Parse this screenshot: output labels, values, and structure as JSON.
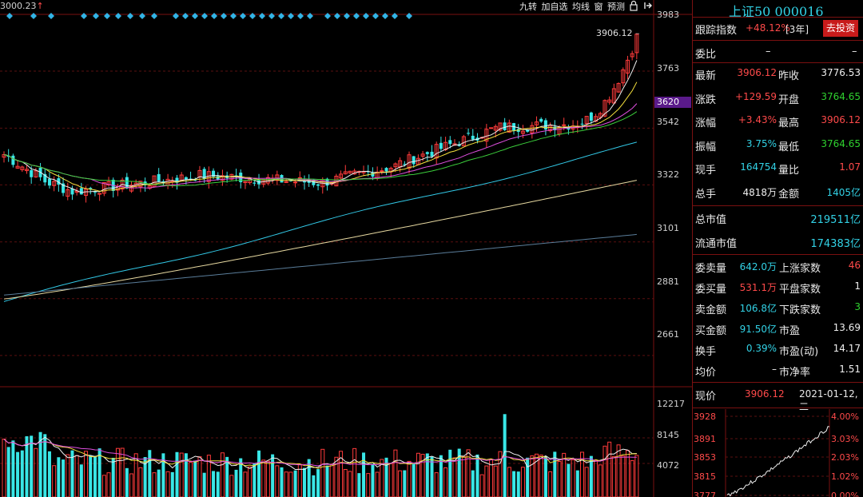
{
  "toolbar": {
    "top_left_label": "3000.23",
    "buttons": [
      "九转",
      "加自选",
      "均线",
      "窗",
      "预测"
    ],
    "lock_icon": "lock-icon",
    "pin_icon": "pin-icon"
  },
  "price_axis": {
    "labels": [
      "3983",
      "3763",
      "3620",
      "3542",
      "3322",
      "3101",
      "2881",
      "2661"
    ],
    "highlight": "3620",
    "highlight_color": "#5a1a8a"
  },
  "volume_axis": {
    "labels": [
      "12217",
      "8145",
      "4072"
    ]
  },
  "chart_annotation": {
    "high_label": "3906.12"
  },
  "chart_data": {
    "type": "candlestick",
    "y_range": [
      2550,
      3983
    ],
    "last_close": 3906.12,
    "prior_close": 3776.53,
    "open": 3764.65,
    "high": 3906.12,
    "low": 3764.65,
    "moving_averages": [
      "yellow",
      "white",
      "magenta",
      "green",
      "cyan",
      "beige",
      "blue-gray"
    ]
  },
  "panel": {
    "title": "上证50 000016",
    "track_label": "跟踪指数",
    "track_value": "+48.12%",
    "track_period": "[3年]",
    "invest_button": "去投资",
    "webi_label": "委比",
    "webi_value1": "–",
    "webi_value2": "–",
    "quote": [
      {
        "l1": "最新",
        "v1": "3906.12",
        "c1": "red",
        "l2": "昨收",
        "v2": "3776.53",
        "c2": "white"
      },
      {
        "l1": "涨跌",
        "v1": "+129.59",
        "c1": "red",
        "l2": "开盘",
        "v2": "3764.65",
        "c2": "green"
      },
      {
        "l1": "涨幅",
        "v1": "+3.43%",
        "c1": "red",
        "l2": "最高",
        "v2": "3906.12",
        "c2": "red"
      },
      {
        "l1": "振幅",
        "v1": "3.75%",
        "c1": "cyan",
        "l2": "最低",
        "v2": "3764.65",
        "c2": "green"
      },
      {
        "l1": "现手",
        "v1": "164754",
        "c1": "cyan",
        "l2": "量比",
        "v2": "1.07",
        "c2": "red"
      },
      {
        "l1": "总手",
        "v1": "4818万",
        "c1": "white",
        "l2": "金额",
        "v2": "1405亿",
        "c2": "cyan"
      }
    ],
    "mcap": [
      {
        "l": "总市值",
        "v": "219511亿"
      },
      {
        "l": "流通市值",
        "v": "174383亿"
      }
    ],
    "orders": [
      {
        "l1": "委卖量",
        "v1": "642.0万",
        "c1": "cyan",
        "l2": "上涨家数",
        "v2": "46",
        "c2": "red"
      },
      {
        "l1": "委买量",
        "v1": "531.1万",
        "c1": "red",
        "l2": "平盘家数",
        "v2": "1",
        "c2": "white"
      },
      {
        "l1": "卖金额",
        "v1": "106.8亿",
        "c1": "cyan",
        "l2": "下跌家数",
        "v2": "3",
        "c2": "green"
      },
      {
        "l1": "买金额",
        "v1": "91.50亿",
        "c1": "cyan",
        "l2": "市盈",
        "v2": "13.69",
        "c2": "white"
      },
      {
        "l1": "换手",
        "v1": "0.39%",
        "c1": "cyan",
        "l2": "市盈(动)",
        "v2": "14.17",
        "c2": "white"
      },
      {
        "l1": "均价",
        "v1": "–",
        "c1": "white",
        "l2": "市净率",
        "v2": "1.51",
        "c2": "white"
      }
    ],
    "current_label": "现价",
    "current_value": "3906.12",
    "current_date": "2021-01-12,二",
    "mini_chart": {
      "left_axis": [
        "3928",
        "3891",
        "3853",
        "3815",
        "3777"
      ],
      "right_axis": [
        "4.00%",
        "3.03%",
        "2.03%",
        "1.02%",
        "0.00%"
      ]
    }
  }
}
